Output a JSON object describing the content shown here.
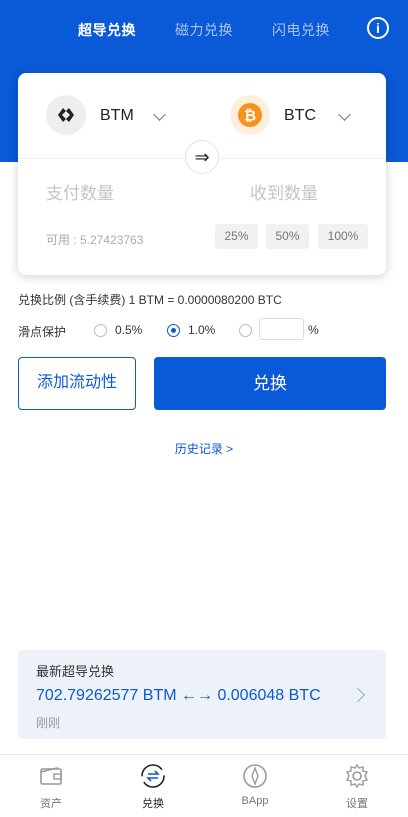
{
  "tabs": [
    {
      "label": "超导兑换",
      "active": true
    },
    {
      "label": "磁力兑换",
      "active": false
    },
    {
      "label": "闪电兑换",
      "active": false
    }
  ],
  "info_icon": "i",
  "swap": {
    "from_coin": "BTM",
    "to_coin": "BTC",
    "swap_glyph": "⇒",
    "pay_placeholder": "支付数量",
    "receive_placeholder": "收到数量",
    "available": "可用 : 5.27423763",
    "percent_options": [
      "25%",
      "50%",
      "100%"
    ]
  },
  "rate": "兑换比例 (含手续费) 1 BTM = 0.0000080200 BTC",
  "slippage": {
    "label": "滑点保护",
    "options": [
      "0.5%",
      "1.0%"
    ],
    "selected": "1.0%",
    "custom_suffix": "%"
  },
  "buttons": {
    "add_liquidity": "添加流动性",
    "swap": "兑换"
  },
  "history_link": "历史记录 >",
  "latest": {
    "title": "最新超导兑换",
    "value": "702.79262577 BTM ←→ 0.006048 BTC",
    "time": "刚刚"
  },
  "nav": [
    {
      "label": "资产",
      "icon": "wallet-icon",
      "active": false
    },
    {
      "label": "兑换",
      "icon": "exchange-icon",
      "active": true
    },
    {
      "label": "BApp",
      "icon": "compass-icon",
      "active": false
    },
    {
      "label": "设置",
      "icon": "gear-icon",
      "active": false
    }
  ],
  "colors": {
    "primary": "#0a59d6",
    "btc": "#f7931a",
    "btm_bg": "#eeeeee"
  }
}
